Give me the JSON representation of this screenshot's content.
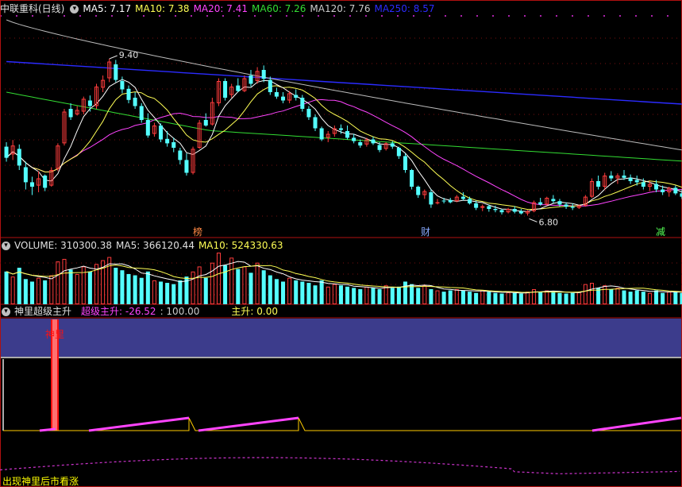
{
  "colors": {
    "up": "#ff3c3c",
    "down": "#54ffff",
    "ma5": "#ffffff",
    "ma10": "#ffff55",
    "ma20": "#ff44ff",
    "ma60": "#33dd33",
    "ma120": "#bbbbbb",
    "ma250": "#2b2bff",
    "panel_border": "#b01010",
    "band": "#3c3c8c",
    "shenli": "#ff1010",
    "note": "#ffff00"
  },
  "price_header": {
    "stock": "中联重科(日线)",
    "toggle_icon": "▾",
    "ma5": "MA5: 7.17",
    "ma10": "MA10: 7.38",
    "ma20": "MA20: 7.41",
    "ma60": "MA60: 7.26",
    "ma120": "MA120: 7.76",
    "ma250": "MA250: 8.57"
  },
  "volume_header": {
    "label": "VOLUME: 310300.38",
    "ma5": "MA5: 366120.44",
    "ma10": "MA10: 524330.63"
  },
  "indicator_header": {
    "name": "神里超级主升",
    "super": "超级主升: -26.52",
    "scale": ": 100.00",
    "main": "主升: 0.00"
  },
  "annotations": {
    "high": "9.40",
    "low": "6.80",
    "tag1": "榜",
    "tag2": "财",
    "tag3": "减",
    "shenli": "神里",
    "note": "出现神里后市看涨"
  },
  "chart_data": {
    "type": "candlestick",
    "y_range": [
      6.2,
      10.2
    ],
    "candles": [
      [
        7.82,
        7.9,
        7.55,
        7.62
      ],
      [
        7.68,
        7.94,
        7.58,
        7.84
      ],
      [
        7.78,
        7.86,
        7.4,
        7.48
      ],
      [
        7.45,
        7.55,
        7.05,
        7.18
      ],
      [
        7.18,
        7.28,
        6.95,
        7.1
      ],
      [
        7.12,
        7.38,
        7.0,
        7.25
      ],
      [
        7.3,
        7.32,
        7.02,
        7.08
      ],
      [
        7.12,
        7.45,
        7.1,
        7.4
      ],
      [
        7.42,
        7.88,
        7.38,
        7.84
      ],
      [
        7.88,
        8.5,
        7.84,
        8.45
      ],
      [
        8.5,
        8.6,
        8.3,
        8.35
      ],
      [
        8.4,
        8.55,
        8.38,
        8.48
      ],
      [
        8.45,
        8.72,
        8.4,
        8.68
      ],
      [
        8.65,
        8.74,
        8.45,
        8.55
      ],
      [
        8.55,
        8.95,
        8.5,
        8.9
      ],
      [
        8.88,
        9.1,
        8.8,
        9.02
      ],
      [
        9.05,
        9.4,
        8.98,
        9.35
      ],
      [
        9.3,
        9.38,
        8.98,
        9.02
      ],
      [
        9.0,
        9.08,
        8.78,
        8.85
      ],
      [
        8.86,
        8.92,
        8.6,
        8.66
      ],
      [
        8.7,
        8.8,
        8.5,
        8.55
      ],
      [
        8.55,
        8.6,
        8.25,
        8.3
      ],
      [
        8.3,
        8.42,
        7.98,
        8.02
      ],
      [
        8.05,
        8.25,
        8.0,
        8.2
      ],
      [
        8.2,
        8.24,
        7.9,
        7.95
      ],
      [
        7.96,
        8.1,
        7.82,
        7.88
      ],
      [
        7.9,
        7.98,
        7.72,
        7.8
      ],
      [
        7.75,
        7.8,
        7.5,
        7.58
      ],
      [
        7.58,
        7.7,
        7.3,
        7.35
      ],
      [
        7.35,
        7.82,
        7.32,
        7.78
      ],
      [
        7.8,
        8.3,
        7.78,
        8.25
      ],
      [
        8.3,
        8.42,
        8.18,
        8.2
      ],
      [
        8.22,
        8.7,
        8.2,
        8.62
      ],
      [
        8.6,
        9.05,
        8.55,
        9.0
      ],
      [
        9.0,
        9.05,
        8.65,
        8.7
      ],
      [
        8.75,
        8.95,
        8.7,
        8.9
      ],
      [
        8.92,
        9.05,
        8.8,
        8.82
      ],
      [
        8.82,
        9.1,
        8.8,
        9.05
      ],
      [
        9.1,
        9.2,
        8.9,
        8.95
      ],
      [
        9.0,
        9.25,
        8.95,
        9.18
      ],
      [
        9.2,
        9.28,
        8.98,
        9.04
      ],
      [
        9.02,
        9.08,
        8.75,
        8.8
      ],
      [
        8.8,
        8.88,
        8.68,
        8.72
      ],
      [
        8.72,
        8.8,
        8.6,
        8.65
      ],
      [
        8.65,
        8.82,
        8.6,
        8.78
      ],
      [
        8.75,
        8.85,
        8.65,
        8.7
      ],
      [
        8.7,
        8.75,
        8.45,
        8.5
      ],
      [
        8.5,
        8.55,
        8.3,
        8.35
      ],
      [
        8.35,
        8.4,
        8.1,
        8.15
      ],
      [
        8.15,
        8.18,
        7.92,
        7.95
      ],
      [
        7.98,
        8.1,
        7.9,
        8.05
      ],
      [
        8.05,
        8.2,
        8.0,
        8.15
      ],
      [
        8.15,
        8.22,
        8.05,
        8.12
      ],
      [
        8.1,
        8.2,
        7.95,
        7.98
      ],
      [
        7.98,
        8.05,
        7.88,
        7.92
      ],
      [
        7.9,
        7.95,
        7.8,
        7.84
      ],
      [
        7.86,
        7.98,
        7.82,
        7.95
      ],
      [
        7.95,
        8.0,
        7.85,
        7.88
      ],
      [
        7.85,
        7.9,
        7.72,
        7.76
      ],
      [
        7.78,
        7.9,
        7.75,
        7.88
      ],
      [
        7.88,
        7.92,
        7.78,
        7.82
      ],
      [
        7.8,
        7.82,
        7.6,
        7.65
      ],
      [
        7.65,
        7.7,
        7.35,
        7.4
      ],
      [
        7.4,
        7.42,
        7.05,
        7.1
      ],
      [
        7.1,
        7.12,
        6.9,
        6.95
      ],
      [
        6.95,
        7.05,
        6.88,
        7.02
      ],
      [
        7.0,
        7.05,
        6.72,
        6.78
      ],
      [
        6.8,
        6.88,
        6.78,
        6.82
      ],
      [
        6.85,
        6.9,
        6.8,
        6.84
      ],
      [
        6.86,
        6.9,
        6.8,
        6.82
      ],
      [
        6.84,
        6.95,
        6.82,
        6.92
      ],
      [
        6.92,
        7.0,
        6.85,
        6.88
      ],
      [
        6.88,
        6.92,
        6.78,
        6.8
      ],
      [
        6.8,
        6.85,
        6.68,
        6.72
      ],
      [
        6.72,
        6.78,
        6.66,
        6.75
      ],
      [
        6.75,
        6.78,
        6.65,
        6.7
      ],
      [
        6.7,
        6.76,
        6.64,
        6.68
      ],
      [
        6.68,
        6.7,
        6.6,
        6.64
      ],
      [
        6.64,
        6.72,
        6.62,
        6.7
      ],
      [
        6.7,
        6.75,
        6.62,
        6.65
      ],
      [
        6.66,
        6.7,
        6.6,
        6.62
      ],
      [
        6.62,
        6.68,
        6.58,
        6.66
      ],
      [
        6.66,
        6.85,
        6.64,
        6.82
      ],
      [
        6.82,
        6.9,
        6.76,
        6.78
      ],
      [
        6.78,
        6.92,
        6.76,
        6.9
      ],
      [
        6.88,
        6.95,
        6.8,
        6.84
      ],
      [
        6.84,
        6.88,
        6.74,
        6.78
      ],
      [
        6.78,
        6.82,
        6.7,
        6.74
      ],
      [
        6.74,
        6.8,
        6.68,
        6.72
      ],
      [
        6.72,
        6.78,
        6.7,
        6.76
      ],
      [
        6.76,
        6.95,
        6.74,
        6.92
      ],
      [
        6.92,
        7.25,
        6.9,
        7.2
      ],
      [
        7.2,
        7.3,
        7.05,
        7.1
      ],
      [
        7.1,
        7.35,
        7.05,
        7.3
      ],
      [
        7.3,
        7.38,
        7.2,
        7.25
      ],
      [
        7.25,
        7.34,
        7.15,
        7.3
      ],
      [
        7.3,
        7.4,
        7.22,
        7.26
      ],
      [
        7.26,
        7.32,
        7.15,
        7.2
      ],
      [
        7.22,
        7.3,
        7.12,
        7.18
      ],
      [
        7.18,
        7.25,
        7.05,
        7.1
      ],
      [
        7.1,
        7.2,
        7.02,
        7.15
      ],
      [
        7.15,
        7.22,
        7.0,
        7.05
      ],
      [
        7.05,
        7.12,
        6.95,
        7.0
      ],
      [
        7.0,
        7.1,
        6.92,
        7.08
      ],
      [
        7.08,
        7.12,
        6.95,
        6.98
      ],
      [
        6.98,
        7.05,
        6.88,
        6.92
      ]
    ],
    "volume": [
      52,
      44,
      58,
      40,
      36,
      42,
      38,
      46,
      68,
      72,
      55,
      48,
      60,
      52,
      64,
      70,
      75,
      58,
      54,
      48,
      46,
      42,
      52,
      38,
      36,
      34,
      32,
      38,
      44,
      52,
      60,
      42,
      66,
      82,
      62,
      74,
      56,
      60,
      50,
      66,
      54,
      46,
      40,
      36,
      42,
      38,
      36,
      34,
      30,
      38,
      28,
      32,
      30,
      28,
      26,
      24,
      28,
      26,
      24,
      30,
      26,
      28,
      36,
      32,
      26,
      30,
      24,
      22,
      20,
      22,
      24,
      22,
      20,
      18,
      22,
      20,
      18,
      17,
      19,
      18,
      17,
      20,
      24,
      20,
      22,
      19,
      18,
      17,
      18,
      20,
      32,
      34,
      26,
      30,
      24,
      26,
      22,
      20,
      22,
      20,
      18,
      22,
      18,
      20,
      19,
      18
    ],
    "ma_end_values": {
      "MA5": 7.17,
      "MA10": 7.38,
      "MA20": 7.41,
      "MA60": 7.26,
      "MA120": 7.76,
      "MA250": 8.57
    }
  }
}
